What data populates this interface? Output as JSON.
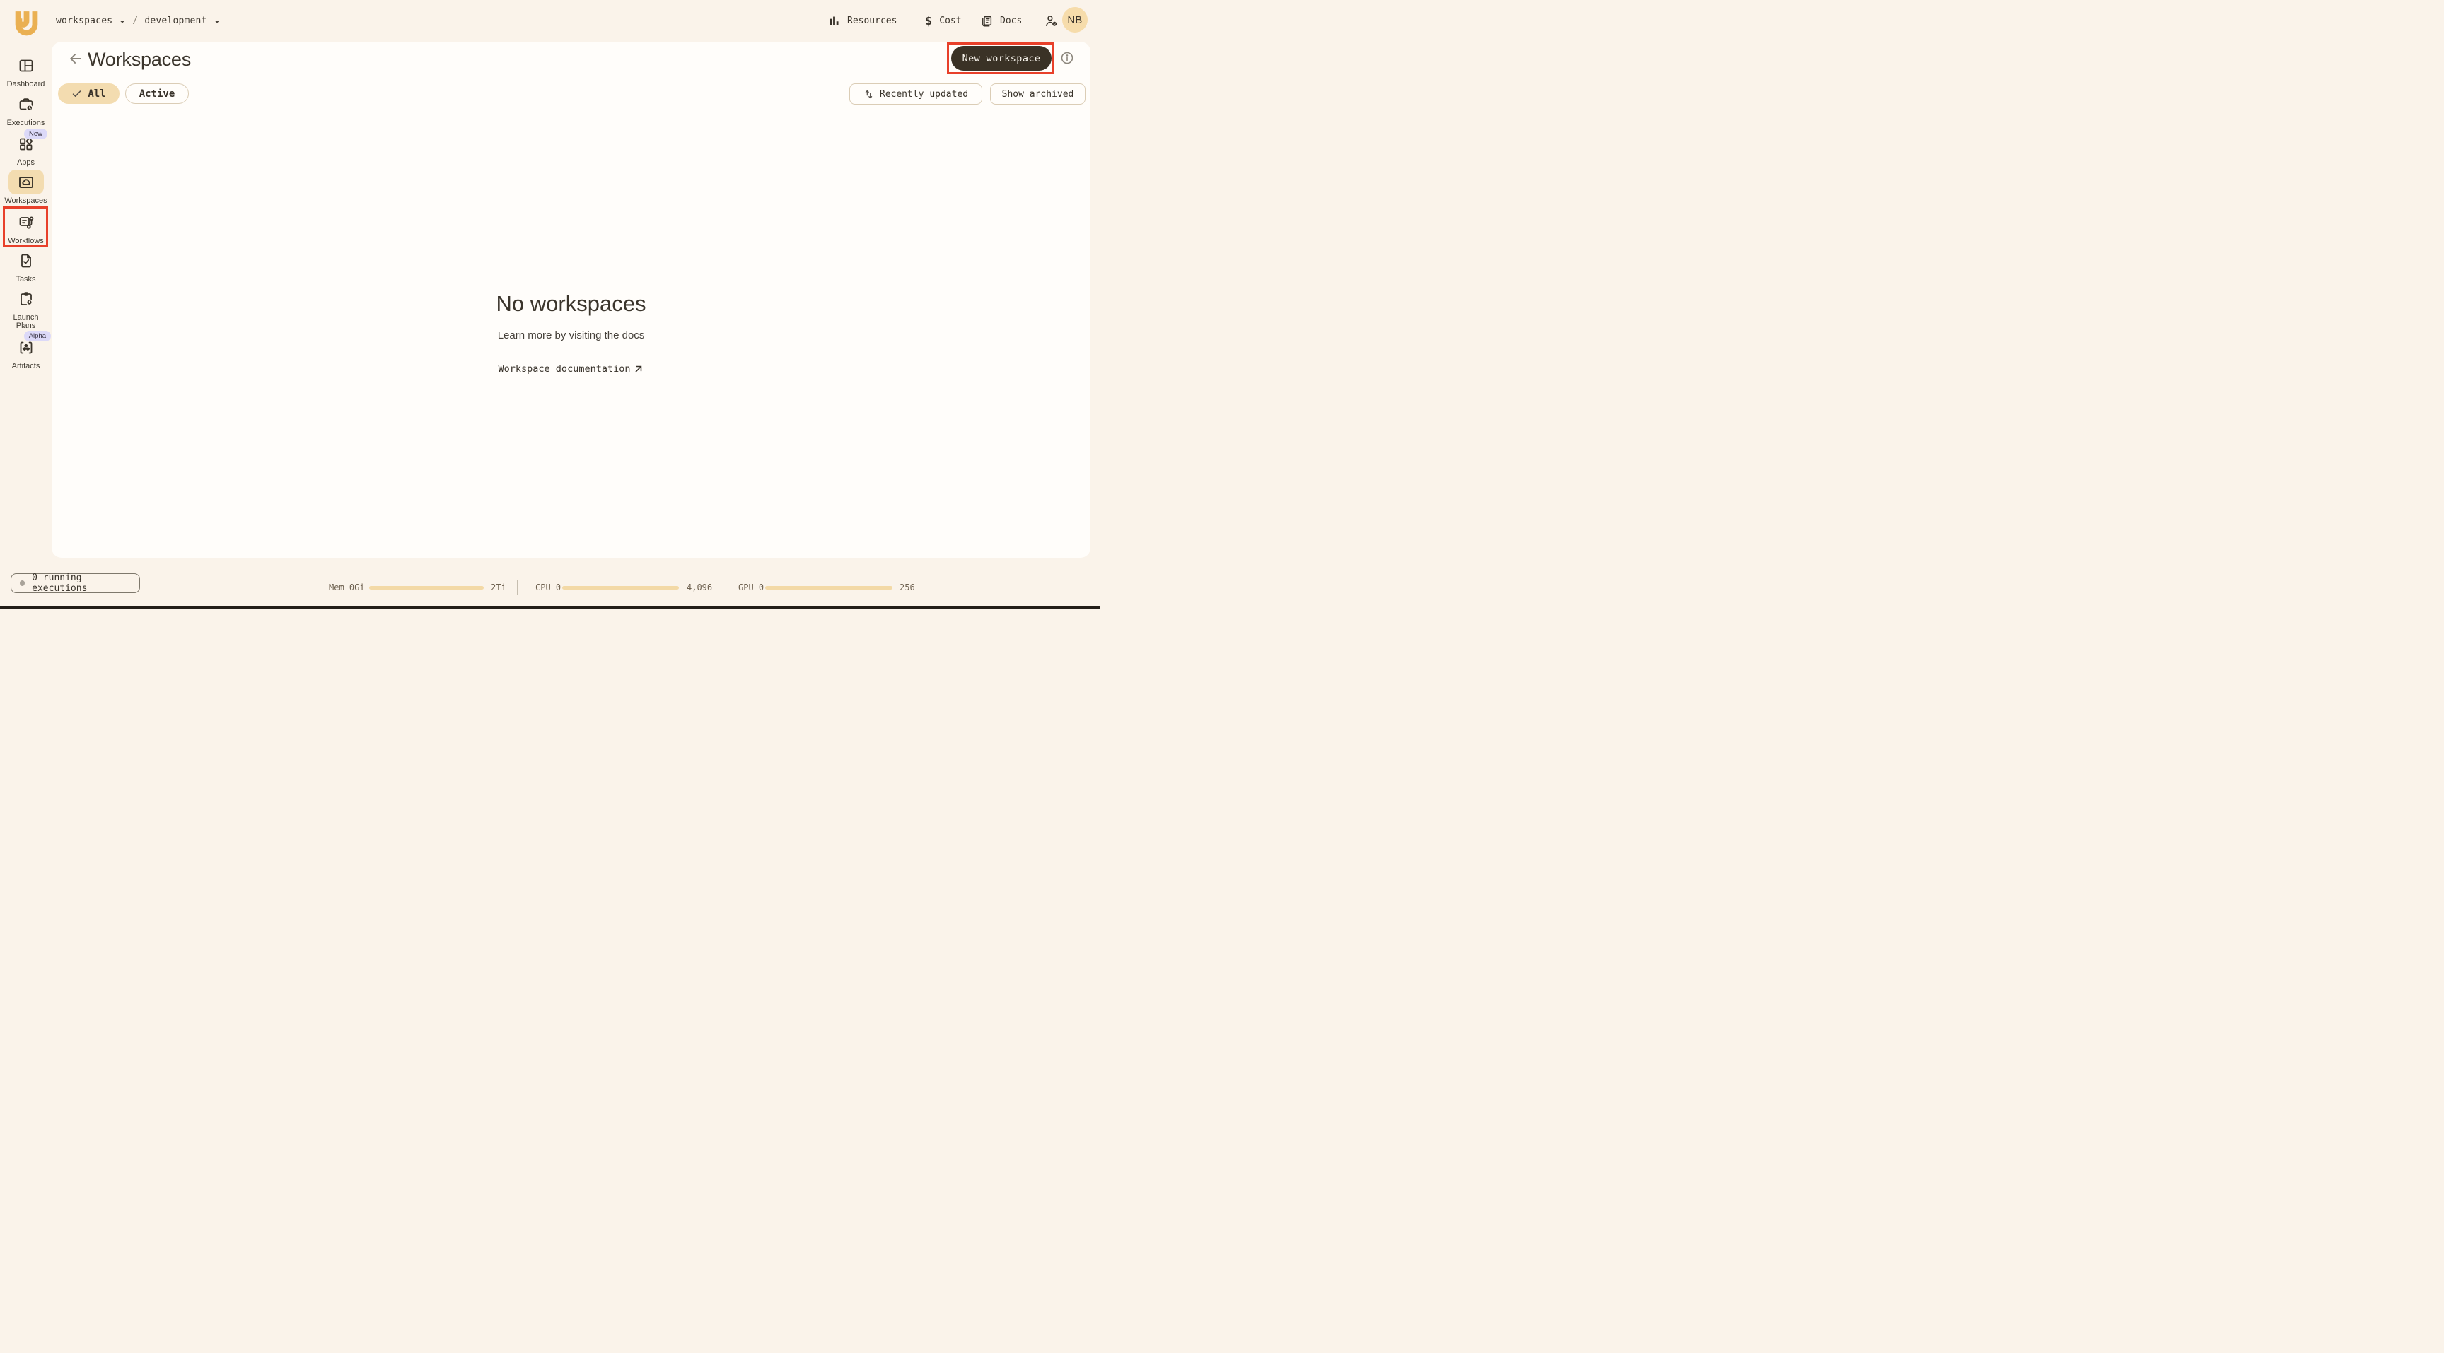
{
  "topbar": {
    "breadcrumb": {
      "crumbs": [
        "workspaces",
        "development"
      ],
      "separator": "/"
    },
    "nav": [
      {
        "label": "Resources",
        "icon": "bar-chart-icon"
      },
      {
        "label": "Cost",
        "icon": "dollar-icon",
        "dollar_glyph": "$"
      },
      {
        "label": "Docs",
        "icon": "docs-icon"
      }
    ],
    "user_settings_icon": "user-gear-icon",
    "avatar_initials": "NB"
  },
  "sidebar": {
    "items": [
      {
        "label": "Dashboard",
        "icon": "dashboard-icon"
      },
      {
        "label": "Executions",
        "icon": "executions-icon"
      },
      {
        "label": "Apps",
        "icon": "apps-icon",
        "badge": "New"
      },
      {
        "label": "Workspaces",
        "icon": "workspaces-icon",
        "active": true
      },
      {
        "label": "Workflows",
        "icon": "workflows-icon"
      },
      {
        "label": "Tasks",
        "icon": "tasks-icon"
      },
      {
        "label": "Launch Plans",
        "icon": "launch-plans-icon"
      },
      {
        "label": "Artifacts",
        "icon": "artifacts-icon",
        "badge": "Alpha"
      }
    ]
  },
  "page": {
    "title": "Workspaces",
    "primary_action": "New workspace",
    "filters": [
      {
        "label": "All",
        "selected": true
      },
      {
        "label": "Active",
        "selected": false
      }
    ],
    "sort_button": "Recently updated",
    "archived_button": "Show archived"
  },
  "empty_state": {
    "title": "No workspaces",
    "subtitle": "Learn more by visiting the docs",
    "link": "Workspace documentation"
  },
  "status_bar": {
    "executions_summary": "0 running executions",
    "meters": [
      {
        "label": "Mem",
        "current": "0Gi",
        "max": "2Ti"
      },
      {
        "label": "CPU",
        "current": "0",
        "max": "4,096"
      },
      {
        "label": "GPU",
        "current": "0",
        "max": "256"
      }
    ]
  },
  "annotations": {
    "highlight_color": "#e8402a",
    "highlighted": [
      "sidebar-item-workspaces",
      "new-workspace-button"
    ]
  },
  "colors": {
    "background": "#faf3ea",
    "panel": "#fffdfa",
    "text_dark": "#38322a",
    "accent_tan": "#f3dcb0",
    "button_dark": "#3a3226",
    "badge_lavender": "#dcd9f8",
    "logo_orange": "#eab052",
    "meter_bar": "#f3d9a6",
    "annotation_red": "#e8402a",
    "avatar_bg": "#f6dcab"
  }
}
